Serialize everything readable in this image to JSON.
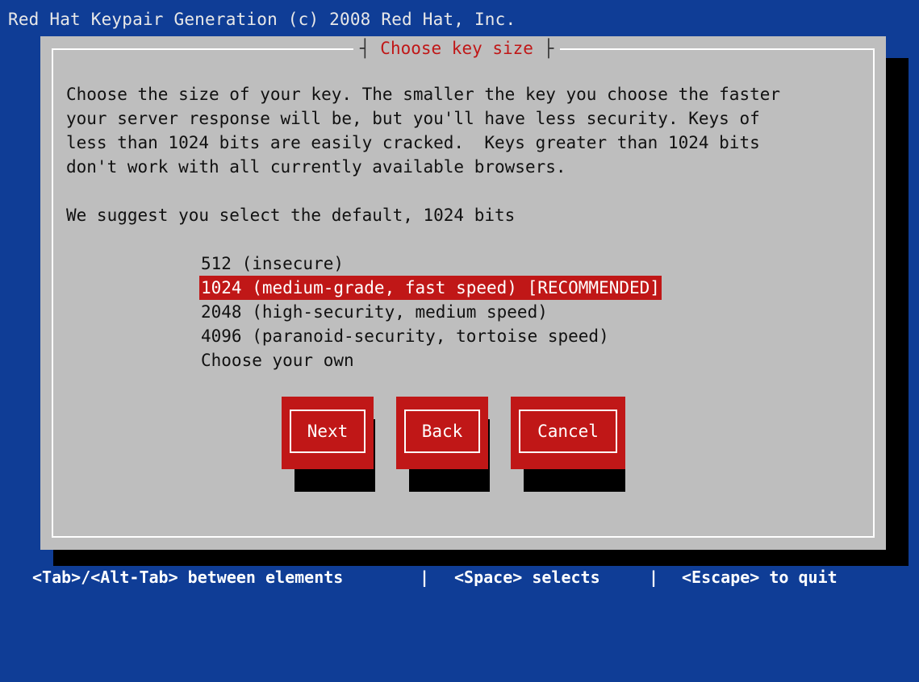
{
  "window": {
    "title": "Red Hat Keypair Generation (c) 2008 Red Hat, Inc."
  },
  "dialog": {
    "title": "Choose key size",
    "description_lines": [
      "Choose the size of your key. The smaller the key you choose the faster",
      "your server response will be, but you'll have less security. Keys of",
      "less than 1024 bits are easily cracked.  Keys greater than 1024 bits",
      "don't work with all currently available browsers."
    ],
    "suggestion": "We suggest you select the default, 1024 bits",
    "options": [
      {
        "label": "512 (insecure)",
        "selected": false
      },
      {
        "label": "1024 (medium-grade, fast speed) [RECOMMENDED]",
        "selected": true
      },
      {
        "label": "2048 (high-security, medium speed)",
        "selected": false
      },
      {
        "label": "4096 (paranoid-security, tortoise speed)",
        "selected": false
      },
      {
        "label": "Choose your own",
        "selected": false
      }
    ],
    "buttons": {
      "next": "Next",
      "back": "Back",
      "cancel": "Cancel"
    }
  },
  "help_bar": {
    "tab_hint": "<Tab>/<Alt-Tab> between elements",
    "sep1": "|",
    "space_hint": "<Space> selects",
    "sep2": "|",
    "escape_hint": "<Escape> to quit"
  },
  "colors": {
    "background": "#0f3d96",
    "dialog": "#bebebe",
    "accent": "#c01717",
    "shadow": "#000000"
  }
}
